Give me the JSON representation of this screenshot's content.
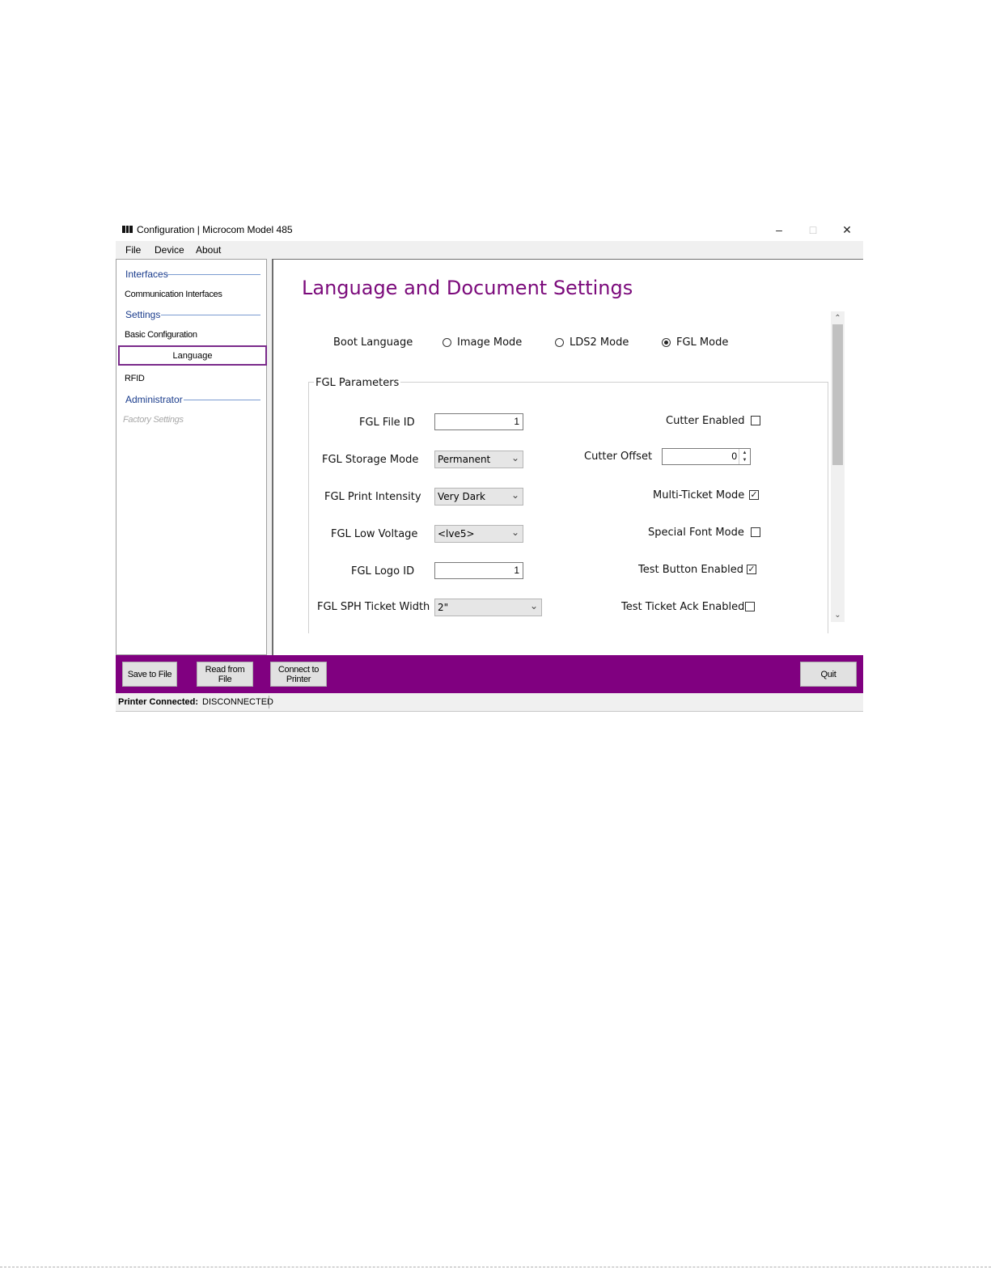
{
  "window": {
    "title": "Configuration | Microcom Model 485",
    "minimize": "–",
    "maximize": "□",
    "close": "✕"
  },
  "menu": [
    "File",
    "Device",
    "About"
  ],
  "sidebar": {
    "interfaces_header": "Interfaces",
    "communication_interfaces": "Communication Interfaces",
    "settings_header": "Settings",
    "basic_configuration": "Basic Configuration",
    "language": "Language",
    "rfid": "RFID",
    "administrator_header": "Administrator",
    "factory_settings": "Factory Settings"
  },
  "page": {
    "title": "Language and Document Settings",
    "boot_language_label": "Boot Language",
    "radio_options": [
      "Image Mode",
      "LDS2 Mode",
      "FGL Mode"
    ],
    "selected_boot_language": "FGL Mode",
    "group_title": "FGL Parameters",
    "fgl_file_id_label": "FGL File ID",
    "fgl_file_id_value": "1",
    "fgl_storage_mode_label": "FGL Storage Mode",
    "fgl_storage_mode_value": "Permanent",
    "fgl_print_intensity_label": "FGL Print Intensity",
    "fgl_print_intensity_value": "Very Dark",
    "fgl_low_voltage_label": "FGL Low Voltage",
    "fgl_low_voltage_value": "<lve5>",
    "fgl_logo_id_label": "FGL Logo ID",
    "fgl_logo_id_value": "1",
    "fgl_sph_ticket_width_label": "FGL SPH Ticket Width",
    "fgl_sph_ticket_width_value": "2\"",
    "cutter_enabled_label": "Cutter Enabled",
    "cutter_enabled": false,
    "cutter_offset_label": "Cutter Offset",
    "cutter_offset_value": "0",
    "multi_ticket_mode_label": "Multi-Ticket Mode",
    "multi_ticket_mode": true,
    "special_font_mode_label": "Special Font Mode",
    "special_font_mode": false,
    "test_button_enabled_label": "Test Button Enabled",
    "test_button_enabled": true,
    "test_ticket_ack_enabled_label": "Test Ticket Ack Enabled",
    "test_ticket_ack_enabled": false,
    "check_mark": "✓"
  },
  "footer": {
    "save_to_file": "Save to File",
    "read_from_file": "Read from\nFile",
    "connect_to_printer": "Connect to\nPrinter",
    "quit": "Quit"
  },
  "status": {
    "label": "Printer Connected:",
    "value": "DISCONNECTED"
  },
  "colors": {
    "accent": "#800080",
    "title": "#7b0a7b",
    "section_header": "#1a3c8c"
  }
}
